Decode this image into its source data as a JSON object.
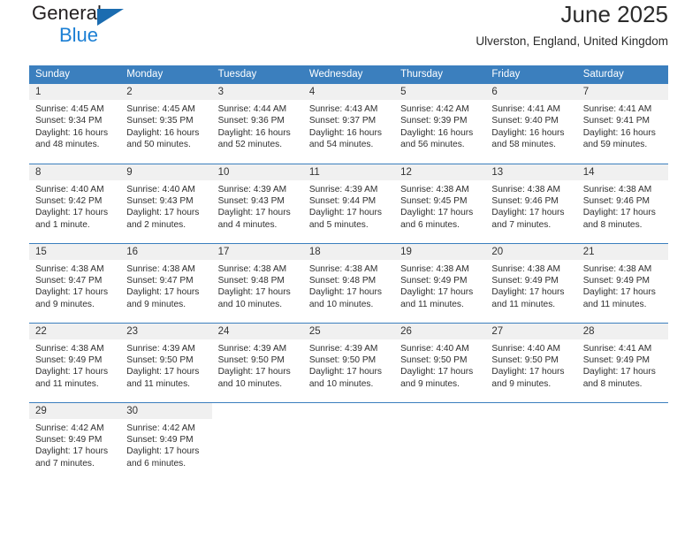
{
  "brand": {
    "word1": "General",
    "word2": "Blue",
    "triangle_color": "#1b6cb0",
    "word2_color": "#1b7fd4"
  },
  "header": {
    "title": "June 2025",
    "subtitle": "Ulverston, England, United Kingdom"
  },
  "theme": {
    "header_blue": "#3b7fbe",
    "daynum_gray": "#f0f0f0",
    "text": "#2f2f2f"
  },
  "weekday_headers": [
    "Sunday",
    "Monday",
    "Tuesday",
    "Wednesday",
    "Thursday",
    "Friday",
    "Saturday"
  ],
  "labels": {
    "sunrise": "Sunrise:",
    "sunset": "Sunset:",
    "daylight": "Daylight:"
  },
  "days": [
    {
      "n": "1",
      "sunrise": "Sunrise: 4:45 AM",
      "sunset": "Sunset: 9:34 PM",
      "d1": "Daylight: 16 hours",
      "d2": "and 48 minutes."
    },
    {
      "n": "2",
      "sunrise": "Sunrise: 4:45 AM",
      "sunset": "Sunset: 9:35 PM",
      "d1": "Daylight: 16 hours",
      "d2": "and 50 minutes."
    },
    {
      "n": "3",
      "sunrise": "Sunrise: 4:44 AM",
      "sunset": "Sunset: 9:36 PM",
      "d1": "Daylight: 16 hours",
      "d2": "and 52 minutes."
    },
    {
      "n": "4",
      "sunrise": "Sunrise: 4:43 AM",
      "sunset": "Sunset: 9:37 PM",
      "d1": "Daylight: 16 hours",
      "d2": "and 54 minutes."
    },
    {
      "n": "5",
      "sunrise": "Sunrise: 4:42 AM",
      "sunset": "Sunset: 9:39 PM",
      "d1": "Daylight: 16 hours",
      "d2": "and 56 minutes."
    },
    {
      "n": "6",
      "sunrise": "Sunrise: 4:41 AM",
      "sunset": "Sunset: 9:40 PM",
      "d1": "Daylight: 16 hours",
      "d2": "and 58 minutes."
    },
    {
      "n": "7",
      "sunrise": "Sunrise: 4:41 AM",
      "sunset": "Sunset: 9:41 PM",
      "d1": "Daylight: 16 hours",
      "d2": "and 59 minutes."
    },
    {
      "n": "8",
      "sunrise": "Sunrise: 4:40 AM",
      "sunset": "Sunset: 9:42 PM",
      "d1": "Daylight: 17 hours",
      "d2": "and 1 minute."
    },
    {
      "n": "9",
      "sunrise": "Sunrise: 4:40 AM",
      "sunset": "Sunset: 9:43 PM",
      "d1": "Daylight: 17 hours",
      "d2": "and 2 minutes."
    },
    {
      "n": "10",
      "sunrise": "Sunrise: 4:39 AM",
      "sunset": "Sunset: 9:43 PM",
      "d1": "Daylight: 17 hours",
      "d2": "and 4 minutes."
    },
    {
      "n": "11",
      "sunrise": "Sunrise: 4:39 AM",
      "sunset": "Sunset: 9:44 PM",
      "d1": "Daylight: 17 hours",
      "d2": "and 5 minutes."
    },
    {
      "n": "12",
      "sunrise": "Sunrise: 4:38 AM",
      "sunset": "Sunset: 9:45 PM",
      "d1": "Daylight: 17 hours",
      "d2": "and 6 minutes."
    },
    {
      "n": "13",
      "sunrise": "Sunrise: 4:38 AM",
      "sunset": "Sunset: 9:46 PM",
      "d1": "Daylight: 17 hours",
      "d2": "and 7 minutes."
    },
    {
      "n": "14",
      "sunrise": "Sunrise: 4:38 AM",
      "sunset": "Sunset: 9:46 PM",
      "d1": "Daylight: 17 hours",
      "d2": "and 8 minutes."
    },
    {
      "n": "15",
      "sunrise": "Sunrise: 4:38 AM",
      "sunset": "Sunset: 9:47 PM",
      "d1": "Daylight: 17 hours",
      "d2": "and 9 minutes."
    },
    {
      "n": "16",
      "sunrise": "Sunrise: 4:38 AM",
      "sunset": "Sunset: 9:47 PM",
      "d1": "Daylight: 17 hours",
      "d2": "and 9 minutes."
    },
    {
      "n": "17",
      "sunrise": "Sunrise: 4:38 AM",
      "sunset": "Sunset: 9:48 PM",
      "d1": "Daylight: 17 hours",
      "d2": "and 10 minutes."
    },
    {
      "n": "18",
      "sunrise": "Sunrise: 4:38 AM",
      "sunset": "Sunset: 9:48 PM",
      "d1": "Daylight: 17 hours",
      "d2": "and 10 minutes."
    },
    {
      "n": "19",
      "sunrise": "Sunrise: 4:38 AM",
      "sunset": "Sunset: 9:49 PM",
      "d1": "Daylight: 17 hours",
      "d2": "and 11 minutes."
    },
    {
      "n": "20",
      "sunrise": "Sunrise: 4:38 AM",
      "sunset": "Sunset: 9:49 PM",
      "d1": "Daylight: 17 hours",
      "d2": "and 11 minutes."
    },
    {
      "n": "21",
      "sunrise": "Sunrise: 4:38 AM",
      "sunset": "Sunset: 9:49 PM",
      "d1": "Daylight: 17 hours",
      "d2": "and 11 minutes."
    },
    {
      "n": "22",
      "sunrise": "Sunrise: 4:38 AM",
      "sunset": "Sunset: 9:49 PM",
      "d1": "Daylight: 17 hours",
      "d2": "and 11 minutes."
    },
    {
      "n": "23",
      "sunrise": "Sunrise: 4:39 AM",
      "sunset": "Sunset: 9:50 PM",
      "d1": "Daylight: 17 hours",
      "d2": "and 11 minutes."
    },
    {
      "n": "24",
      "sunrise": "Sunrise: 4:39 AM",
      "sunset": "Sunset: 9:50 PM",
      "d1": "Daylight: 17 hours",
      "d2": "and 10 minutes."
    },
    {
      "n": "25",
      "sunrise": "Sunrise: 4:39 AM",
      "sunset": "Sunset: 9:50 PM",
      "d1": "Daylight: 17 hours",
      "d2": "and 10 minutes."
    },
    {
      "n": "26",
      "sunrise": "Sunrise: 4:40 AM",
      "sunset": "Sunset: 9:50 PM",
      "d1": "Daylight: 17 hours",
      "d2": "and 9 minutes."
    },
    {
      "n": "27",
      "sunrise": "Sunrise: 4:40 AM",
      "sunset": "Sunset: 9:50 PM",
      "d1": "Daylight: 17 hours",
      "d2": "and 9 minutes."
    },
    {
      "n": "28",
      "sunrise": "Sunrise: 4:41 AM",
      "sunset": "Sunset: 9:49 PM",
      "d1": "Daylight: 17 hours",
      "d2": "and 8 minutes."
    },
    {
      "n": "29",
      "sunrise": "Sunrise: 4:42 AM",
      "sunset": "Sunset: 9:49 PM",
      "d1": "Daylight: 17 hours",
      "d2": "and 7 minutes."
    },
    {
      "n": "30",
      "sunrise": "Sunrise: 4:42 AM",
      "sunset": "Sunset: 9:49 PM",
      "d1": "Daylight: 17 hours",
      "d2": "and 6 minutes."
    }
  ]
}
